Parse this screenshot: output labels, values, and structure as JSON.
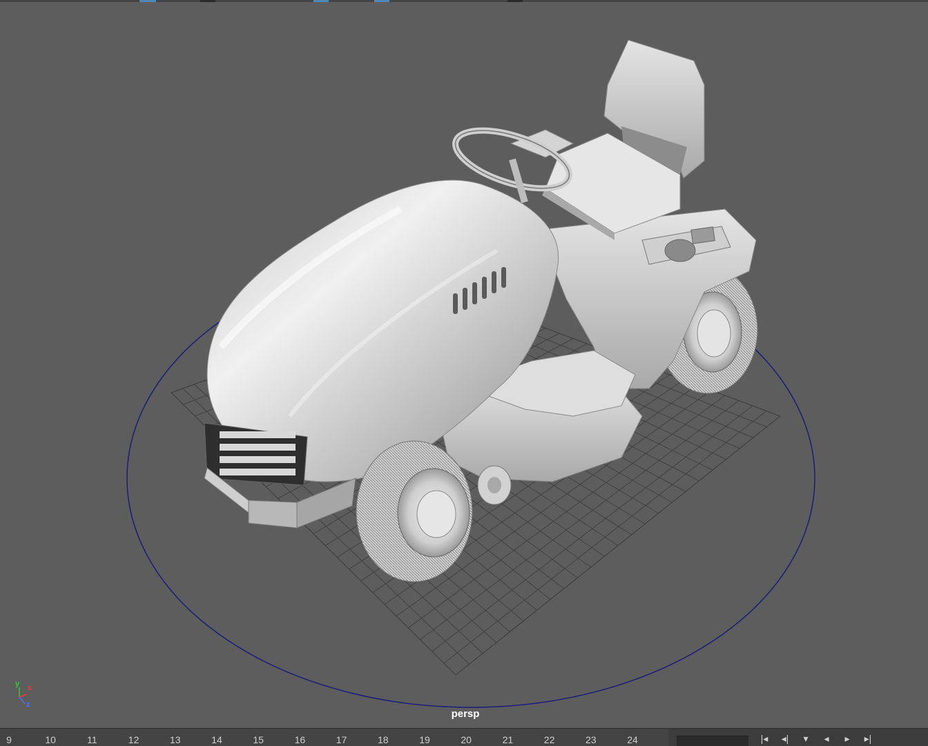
{
  "viewport": {
    "camera_name": "persp",
    "object_icon": "riding-lawn-mower-model",
    "colors": {
      "background": "#5d5d5d",
      "grid": "#3d3d3d",
      "selection_circle": "#1c1c7a",
      "model_shade": "#d7d7d7"
    }
  },
  "axis_gizmo": {
    "labels": {
      "y": "y",
      "x": "x",
      "z": "z"
    },
    "colors": {
      "y": "#33cc33",
      "x": "#ff3333",
      "z": "#4477ff"
    }
  },
  "timeline": {
    "ticks": [
      "9",
      "10",
      "11",
      "12",
      "13",
      "14",
      "15",
      "16",
      "17",
      "18",
      "19",
      "20",
      "21",
      "22",
      "23",
      "24"
    ],
    "playback_icons": [
      "go-to-start-icon",
      "step-back-key-icon",
      "step-back-frame-icon",
      "play-back-icon",
      "play-forward-icon",
      "step-forward-key-icon"
    ]
  }
}
